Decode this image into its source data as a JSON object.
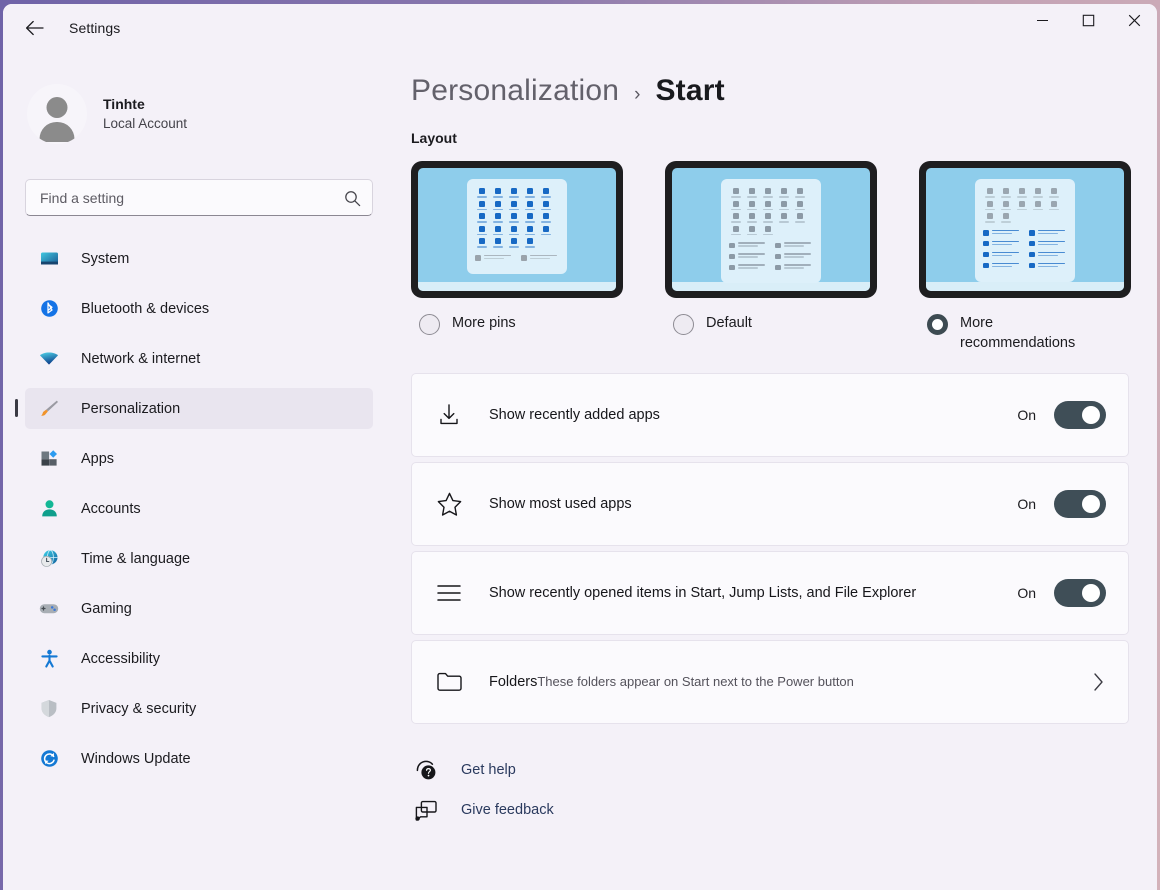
{
  "window": {
    "app_title": "Settings",
    "back_icon": "arrow-left-icon",
    "controls": {
      "minimize": "minimize-icon",
      "maximize": "maximize-icon",
      "close": "close-icon"
    },
    "accent_border": "#6f63a8"
  },
  "account": {
    "name": "Tinhte",
    "type": "Local Account",
    "avatar_icon": "person-avatar-icon"
  },
  "search": {
    "placeholder": "Find a setting",
    "value": "",
    "icon": "search-icon"
  },
  "sidebar": {
    "items": [
      {
        "label": "System",
        "icon": "monitor-icon",
        "selected": false
      },
      {
        "label": "Bluetooth & devices",
        "icon": "bluetooth-icon",
        "selected": false
      },
      {
        "label": "Network & internet",
        "icon": "wifi-icon",
        "selected": false
      },
      {
        "label": "Personalization",
        "icon": "paintbrush-icon",
        "selected": true
      },
      {
        "label": "Apps",
        "icon": "apps-icon",
        "selected": false
      },
      {
        "label": "Accounts",
        "icon": "account-icon",
        "selected": false
      },
      {
        "label": "Time & language",
        "icon": "clock-globe-icon",
        "selected": false
      },
      {
        "label": "Gaming",
        "icon": "gamepad-icon",
        "selected": false
      },
      {
        "label": "Accessibility",
        "icon": "accessibility-icon",
        "selected": false
      },
      {
        "label": "Privacy & security",
        "icon": "shield-icon",
        "selected": false
      },
      {
        "label": "Windows Update",
        "icon": "update-refresh-icon",
        "selected": false
      }
    ]
  },
  "breadcrumb": {
    "parent": "Personalization",
    "separator": "›",
    "current": "Start"
  },
  "layout_section": {
    "heading": "Layout",
    "options": [
      {
        "label": "More pins",
        "selected": false,
        "pin_rows": 4,
        "pin_cols": 6,
        "pin_color": "#1769c4",
        "rec_rows": 1,
        "rec_cols": 2,
        "rec_color": "#9aa3ab"
      },
      {
        "label": "Default",
        "selected": false,
        "pin_rows": 3,
        "pin_cols": 6,
        "pin_color": "#8c9aa6",
        "rec_rows": 3,
        "rec_cols": 2,
        "rec_color": "#8c9aa6"
      },
      {
        "label": "More recommendations",
        "selected": true,
        "pin_rows": 2,
        "pin_cols": 6,
        "pin_color": "#9aa6b0",
        "rec_rows": 4,
        "rec_cols": 2,
        "rec_color": "#1769c4"
      }
    ]
  },
  "settings_cards": [
    {
      "icon": "download-icon",
      "title": "Show recently added apps",
      "sub": "",
      "control": "toggle",
      "state_label": "On",
      "state_on": true
    },
    {
      "icon": "star-icon",
      "title": "Show most used apps",
      "sub": "",
      "control": "toggle",
      "state_label": "On",
      "state_on": true
    },
    {
      "icon": "list-lines-icon",
      "title": "Show recently opened items in Start, Jump Lists, and File Explorer",
      "sub": "",
      "control": "toggle",
      "state_label": "On",
      "state_on": true
    },
    {
      "icon": "folder-icon",
      "title": "Folders",
      "sub": "These folders appear on Start next to the Power button",
      "control": "chevron",
      "state_label": "",
      "state_on": false
    }
  ],
  "footer_links": [
    {
      "label": "Get help",
      "icon": "help-headset-icon"
    },
    {
      "label": "Give feedback",
      "icon": "feedback-icon"
    }
  ]
}
